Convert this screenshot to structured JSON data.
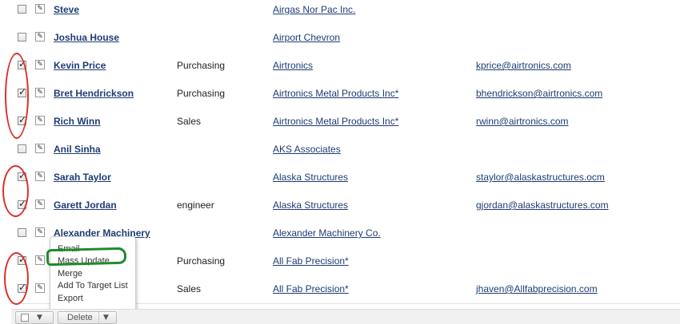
{
  "rows": [
    {
      "name": "Steve",
      "title": "",
      "account": "Airgas Nor Pac Inc.",
      "email": "",
      "checked": false
    },
    {
      "name": "Joshua House",
      "title": "",
      "account": "Airport Chevron",
      "email": "",
      "checked": false
    },
    {
      "name": "Kevin Price",
      "title": "Purchasing",
      "account": "Airtronics",
      "email": "kprice@airtronics.com",
      "checked": true
    },
    {
      "name": "Bret Hendrickson",
      "title": "Purchasing",
      "account": "Airtronics Metal Products Inc*",
      "email": "bhendrickson@airtronics.com",
      "checked": true
    },
    {
      "name": "Rich Winn",
      "title": "Sales",
      "account": "Airtronics Metal Products Inc*",
      "email": "rwinn@airtronics.com",
      "checked": true
    },
    {
      "name": "Anil Sinha",
      "title": "",
      "account": "AKS Associates",
      "email": "",
      "checked": false
    },
    {
      "name": "Sarah Taylor",
      "title": "",
      "account": "Alaska Structures",
      "email": "staylor@alaskastructures.ocm",
      "checked": true
    },
    {
      "name": "Garett Jordan",
      "title": "engineer",
      "account": "Alaska Structures",
      "email": "gjordan@alaskastructures.com",
      "checked": true
    },
    {
      "name": "Alexander Machinery",
      "title": "",
      "account": "Alexander Machinery Co.",
      "email": "",
      "checked": false
    },
    {
      "name": "",
      "title": "Purchasing",
      "account": "All Fab Precision*",
      "email": "",
      "checked": true
    },
    {
      "name": "",
      "title": "Sales",
      "account": "All Fab Precision*",
      "email": "jhaven@Allfabprecision.com",
      "checked": true
    }
  ],
  "menu": {
    "items": [
      "Email",
      "Mass Update",
      "Merge",
      "Add To Target List",
      "Export"
    ]
  },
  "bottombar": {
    "delete_label": "Delete"
  },
  "colors": {
    "link": "#1e3c73",
    "annotation_red": "#d9302c",
    "annotation_green": "#1f8b2c"
  }
}
